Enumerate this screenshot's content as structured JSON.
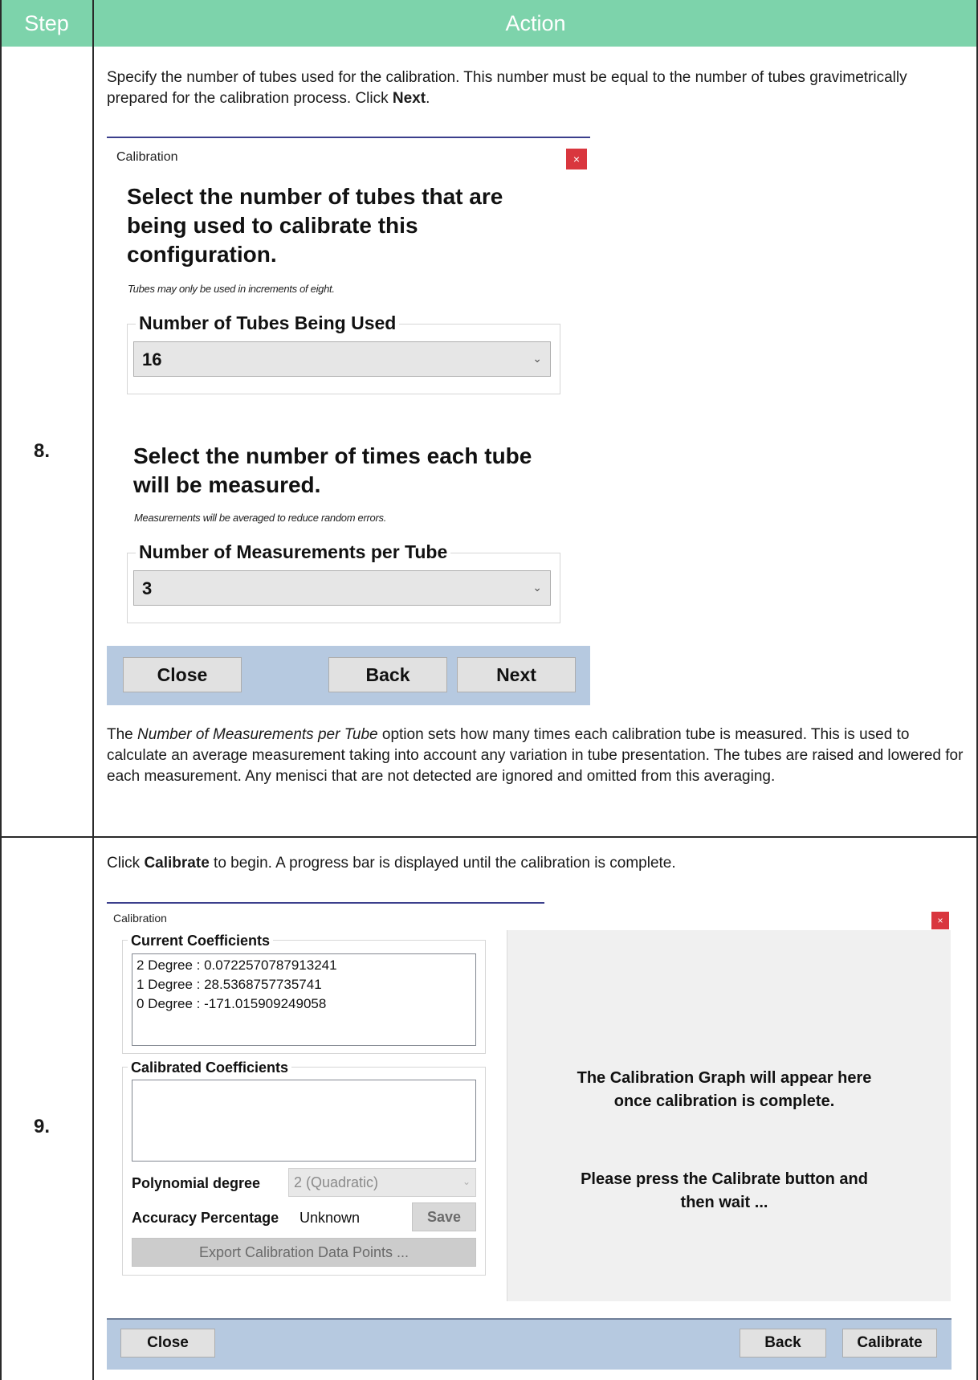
{
  "table": {
    "header": {
      "step": "Step",
      "action": "Action"
    },
    "rows": [
      {
        "step": "8.",
        "intro": {
          "text_1": "Specify the number of tubes used for the calibration. This number must be equal to the number of tubes gravimetrically prepared for the calibration process. Click ",
          "bold": "Next",
          "text_2": "."
        },
        "dialog": {
          "title": "Calibration",
          "close_glyph": "×",
          "heading_1": "Select the number of tubes that are being used to calibrate this configuration.",
          "hint_1": "Tubes may only be used in increments of eight.",
          "group_1": {
            "legend": "Number of Tubes Being Used",
            "value": "16"
          },
          "heading_2": "Select the number of times each tube will be measured.",
          "hint_2": "Measurements will be averaged to reduce random errors.",
          "group_2": {
            "legend": "Number of Measurements per Tube",
            "value": "3"
          },
          "buttons": {
            "close": "Close",
            "back": "Back",
            "next": "Next"
          }
        },
        "note": {
          "text_1": "The ",
          "italic": "Number of Measurements per Tube",
          "text_2": " option sets how many times each calibration tube is measured. This is used to calculate an average measurement taking into account any variation in tube presentation. The tubes are raised and lowered for each measurement. Any menisci that are not detected are ignored and omitted from this averaging."
        }
      },
      {
        "step": "9.",
        "intro": {
          "text_1": "Click ",
          "bold": "Calibrate",
          "text_2": " to begin. A progress bar is displayed until the calibration is complete."
        },
        "dialog": {
          "title": "Calibration",
          "close_glyph": "×",
          "current": {
            "legend": "Current Coefficients",
            "lines": [
              "2 Degree : 0.0722570787913241",
              "1 Degree : 28.5368757735741",
              "0 Degree : -171.015909249058"
            ]
          },
          "calibrated": {
            "legend": "Calibrated Coefficients",
            "poly_label": "Polynomial degree",
            "poly_value": "2 (Quadratic)",
            "accuracy_label": "Accuracy Percentage",
            "accuracy_value": "Unknown",
            "save": "Save",
            "export": "Export Calibration Data Points ..."
          },
          "graph": {
            "line_1": "The Calibration Graph will appear here",
            "line_2": "once calibration is complete.",
            "line_3": "Please press the Calibrate button and",
            "line_4": "then wait ..."
          },
          "buttons": {
            "close": "Close",
            "back": "Back",
            "calibrate": "Calibrate"
          }
        }
      }
    ]
  },
  "colors": {
    "header_green": "#7dd3ab",
    "footer_blue": "#b6c9e0",
    "close_red": "#d9363e"
  }
}
